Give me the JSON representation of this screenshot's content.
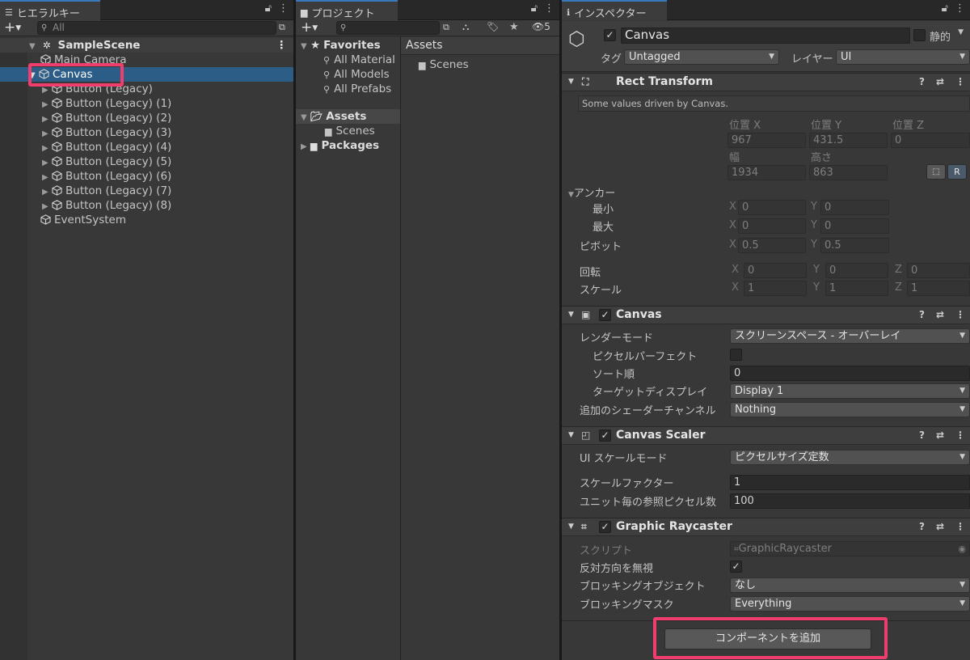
{
  "hierarchy": {
    "tab_title": "ヒエラルキー",
    "search_placeholder": "All",
    "scene_name": "SampleScene",
    "items": [
      {
        "label": "Main Camera",
        "depth": 1
      },
      {
        "label": "Canvas",
        "depth": 1,
        "selected": true
      },
      {
        "label": "Button (Legacy)",
        "depth": 2
      },
      {
        "label": "Button (Legacy) (1)",
        "depth": 2
      },
      {
        "label": "Button (Legacy) (2)",
        "depth": 2
      },
      {
        "label": "Button (Legacy) (3)",
        "depth": 2
      },
      {
        "label": "Button (Legacy) (4)",
        "depth": 2
      },
      {
        "label": "Button (Legacy) (5)",
        "depth": 2
      },
      {
        "label": "Button (Legacy) (6)",
        "depth": 2
      },
      {
        "label": "Button (Legacy) (7)",
        "depth": 2
      },
      {
        "label": "Button (Legacy) (8)",
        "depth": 2
      },
      {
        "label": "EventSystem",
        "depth": 1
      }
    ]
  },
  "project": {
    "tab_title": "プロジェクト",
    "hidden_count": "5",
    "tree": {
      "favorites": "Favorites",
      "fav_items": [
        "All Material",
        "All Models",
        "All Prefabs"
      ],
      "assets": "Assets",
      "scenes": "Scenes",
      "packages": "Packages"
    },
    "breadcrumb": "Assets",
    "folder_items": [
      "Scenes"
    ]
  },
  "inspector": {
    "tab_title": "インスペクター",
    "object_name": "Canvas",
    "static_label": "静的",
    "tag_label": "タグ",
    "tag_value": "Untagged",
    "layer_label": "レイヤー",
    "layer_value": "UI",
    "rect_transform": {
      "title": "Rect Transform",
      "note": "Some values driven by Canvas.",
      "pos_x_label": "位置 X",
      "pos_y_label": "位置 Y",
      "pos_z_label": "位置 Z",
      "pos_x": "967",
      "pos_y": "431.5",
      "pos_z": "0",
      "width_label": "幅",
      "height_label": "高さ",
      "width": "1934",
      "height": "863",
      "r_label": "R",
      "anchors_label": "アンカー",
      "min_label": "最小",
      "max_label": "最大",
      "min_x": "0",
      "min_y": "0",
      "max_x": "0",
      "max_y": "0",
      "pivot_label": "ピボット",
      "pivot_x": "0.5",
      "pivot_y": "0.5",
      "rotation_label": "回転",
      "rot_x": "0",
      "rot_y": "0",
      "rot_z": "0",
      "scale_label": "スケール",
      "scale_x": "1",
      "scale_y": "1",
      "scale_z": "1",
      "axis_x": "X",
      "axis_y": "Y",
      "axis_z": "Z"
    },
    "canvas": {
      "title": "Canvas",
      "render_mode_label": "レンダーモード",
      "render_mode": "スクリーンスペース - オーバーレイ",
      "pixel_perfect_label": "ピクセルパーフェクト",
      "sort_order_label": "ソート順",
      "sort_order": "0",
      "target_display_label": "ターゲットディスプレイ",
      "target_display": "Display 1",
      "shader_channels_label": "追加のシェーダーチャンネル",
      "shader_channels": "Nothing"
    },
    "canvas_scaler": {
      "title": "Canvas Scaler",
      "ui_scale_mode_label": "UI スケールモード",
      "ui_scale_mode": "ピクセルサイズ定数",
      "scale_factor_label": "スケールファクター",
      "scale_factor": "1",
      "ref_ppu_label": "ユニット毎の参照ピクセル数",
      "ref_ppu": "100"
    },
    "graphic_raycaster": {
      "title": "Graphic Raycaster",
      "script_label": "スクリプト",
      "script_value": "GraphicRaycaster",
      "ignore_reversed_label": "反対方向を無視",
      "blocking_objects_label": "ブロッキングオブジェクト",
      "blocking_objects": "なし",
      "blocking_mask_label": "ブロッキングマスク",
      "blocking_mask": "Everything"
    },
    "add_component": "コンポーネントを追加"
  },
  "highlight_color": "#ef3e6e",
  "selection_color": "#2c5d87"
}
